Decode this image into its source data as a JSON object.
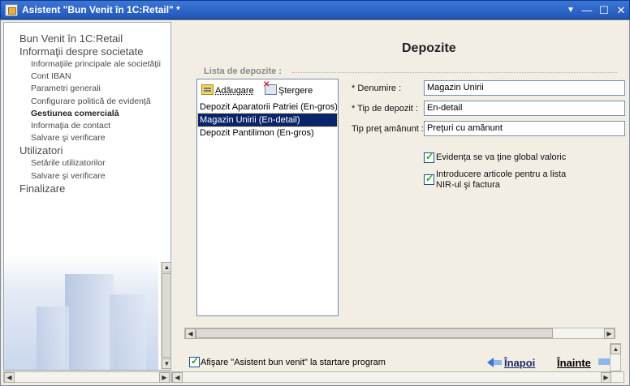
{
  "window": {
    "title": "Asistent \"Bun Venit în 1C:Retail\" *",
    "controls": {
      "menu": "▼",
      "minimize": "—",
      "maximize": "☐",
      "close": "✕"
    }
  },
  "nav": {
    "items": [
      {
        "label": "Bun Venit în 1C:Retail",
        "level": 1
      },
      {
        "label": "Informaţii despre societate",
        "level": 1
      },
      {
        "label": "Informaţiile principale ale societăţii",
        "level": 2
      },
      {
        "label": "Cont IBAN",
        "level": 2
      },
      {
        "label": "Parametri generali",
        "level": 2
      },
      {
        "label": "Configurare politică de evidenţă",
        "level": 2
      },
      {
        "label": "Gestiunea comercială",
        "level": 2,
        "active": true
      },
      {
        "label": "Informaţia de contact",
        "level": 2
      },
      {
        "label": "Salvare şi verificare",
        "level": 2
      },
      {
        "label": "Utilizatori",
        "level": 1
      },
      {
        "label": "Setările utilizatorilor",
        "level": 2
      },
      {
        "label": "Salvare şi verificare",
        "level": 2
      },
      {
        "label": "Finalizare",
        "level": 1
      }
    ]
  },
  "page": {
    "title": "Depozite",
    "group_label": "Lista de depozite :",
    "toolbar": {
      "add_label": "Adăugare",
      "add_underline": "A",
      "delete_label": "Ştergere",
      "delete_underline": "Ş"
    },
    "warehouses": [
      {
        "label": "Depozit Aparatorii Patriei (En-gros)",
        "selected": false
      },
      {
        "label": "Magazin Unirii (En-detail)",
        "selected": true
      },
      {
        "label": "Depozit Pantilimon (En-gros)",
        "selected": false
      }
    ],
    "fields": {
      "name_label": "* Denumire :",
      "name_value": "Magazin Unirii",
      "type_label": "* Tip de depozit :",
      "type_value": "En-detail",
      "price_label": "Tip preţ amănunt :",
      "price_value": "Preţuri cu amănunt"
    },
    "checkboxes": {
      "global_value": {
        "label": "Evidenţa se va ţine global valoric",
        "checked": true
      },
      "nir_invoice": {
        "label_line1": "Introducere articole pentru a lista",
        "label_line2": "NIR-ul şi factura",
        "checked": true
      }
    }
  },
  "footer": {
    "startup_checkbox": {
      "label": "Afişare \"Asistent bun venit\" la startare program",
      "checked": true
    },
    "back_label": "Înapoi",
    "next_label": "Înainte"
  },
  "scroll": {
    "up": "▲",
    "down": "▼",
    "left": "◀",
    "right": "▶"
  },
  "colors": {
    "titlebar": "#2257b8",
    "selection": "#0a246a",
    "check": "#21a121",
    "panel": "#f2eee4"
  }
}
